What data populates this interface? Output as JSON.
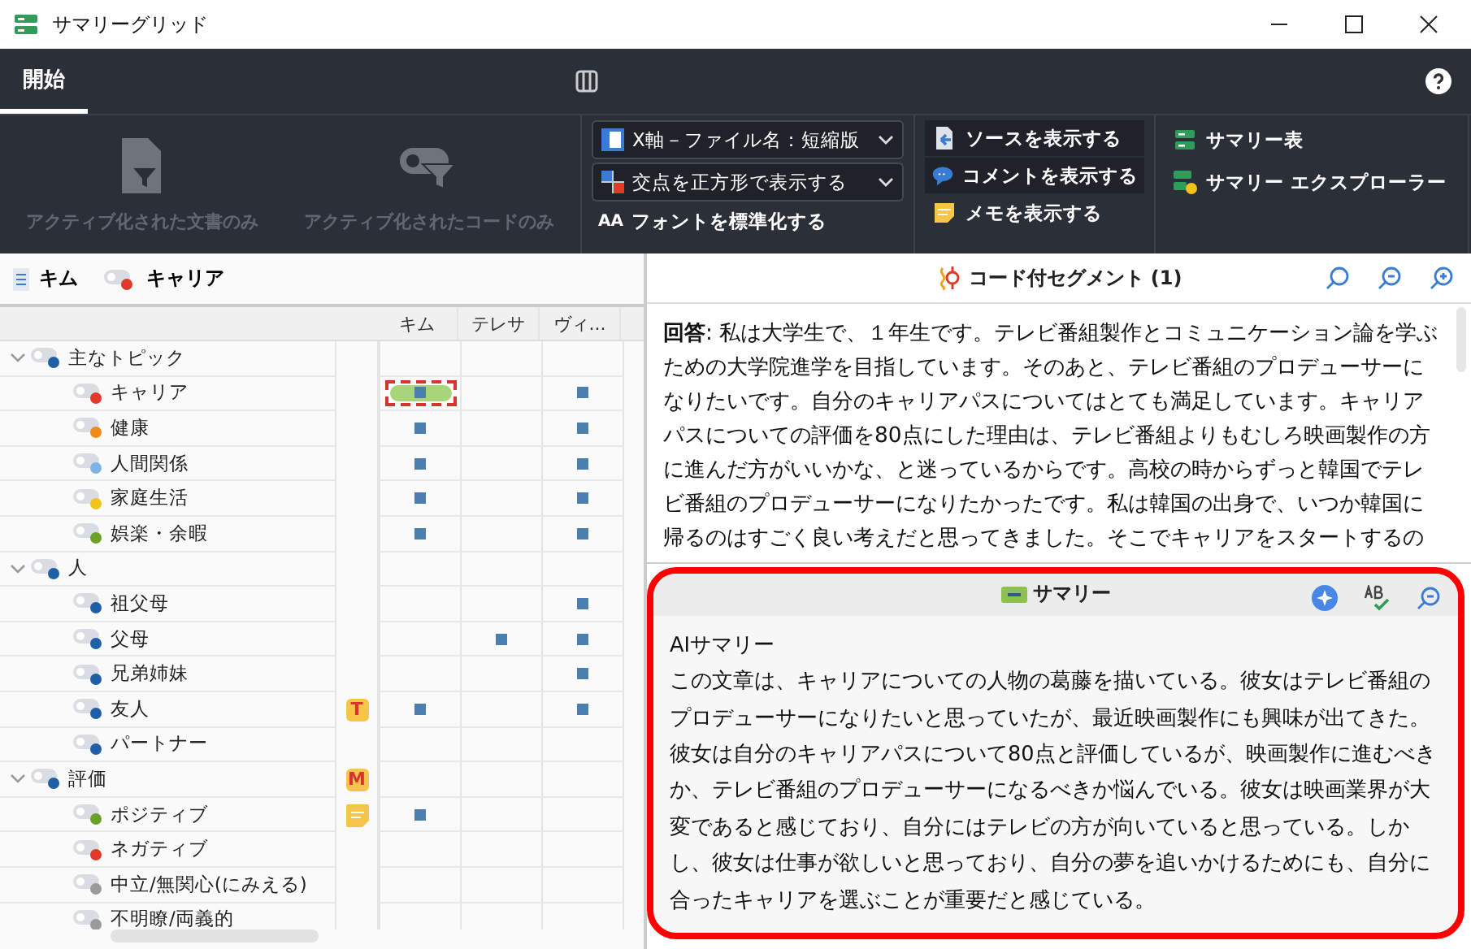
{
  "window": {
    "title": "サマリーグリッド"
  },
  "ribbon_tabs": [
    {
      "label": "開始",
      "selected": true
    }
  ],
  "ribbon": {
    "big_buttons": [
      {
        "label": "アクティブ化された文書のみ",
        "disabled": true,
        "kind": "document"
      },
      {
        "label": "アクティブ化されたコードのみ",
        "disabled": true,
        "kind": "code"
      }
    ],
    "dropdowns": [
      {
        "label": "X軸－ファイル名：短縮版",
        "kind": "axis"
      },
      {
        "label": "交点を正方形で表示する",
        "kind": "squares"
      }
    ],
    "normalize": {
      "icon_text": "AA",
      "label": "フォントを標準化する"
    },
    "toggles": [
      {
        "label": "ソースを表示する",
        "selected": true,
        "kind": "source"
      },
      {
        "label": "コメントを表示する",
        "selected": true,
        "kind": "comment"
      },
      {
        "label": "メモを表示する",
        "selected": false,
        "kind": "memo"
      }
    ],
    "summary_buttons": [
      {
        "label": "サマリー表",
        "kind": "table"
      },
      {
        "label": "サマリー エクスプローラー",
        "kind": "explorer"
      }
    ]
  },
  "selection": [
    {
      "kind": "document",
      "label": "キム"
    },
    {
      "kind": "code",
      "label": "キャリア",
      "color": "#e03a2a"
    }
  ],
  "matrix": {
    "columns": [
      "キム",
      "テレサ",
      "ヴィ..."
    ],
    "tree": [
      {
        "label": "主なトピック",
        "color": "#1f5fa8",
        "expanded": true,
        "children": [
          {
            "label": "キャリア",
            "color": "#e03a2a",
            "cells": [
              {
                "hit": true,
                "selected": true
              },
              {
                "hit": false,
                "selected": false
              },
              {
                "hit": true,
                "selected": false
              }
            ]
          },
          {
            "label": "健康",
            "color": "#f08a1c",
            "cells": [
              {
                "hit": true,
                "selected": false
              },
              {
                "hit": false,
                "selected": false
              },
              {
                "hit": true,
                "selected": false
              }
            ]
          },
          {
            "label": "人間関係",
            "color": "#7fb2e5",
            "cells": [
              {
                "hit": true,
                "selected": false
              },
              {
                "hit": false,
                "selected": false
              },
              {
                "hit": true,
                "selected": false
              }
            ]
          },
          {
            "label": "家庭生活",
            "color": "#f2c418",
            "cells": [
              {
                "hit": true,
                "selected": false
              },
              {
                "hit": false,
                "selected": false
              },
              {
                "hit": true,
                "selected": false
              }
            ]
          },
          {
            "label": "娯楽・余暇",
            "color": "#6aa126",
            "cells": [
              {
                "hit": true,
                "selected": false
              },
              {
                "hit": false,
                "selected": false
              },
              {
                "hit": true,
                "selected": false
              }
            ]
          }
        ]
      },
      {
        "label": "人",
        "color": "#1f5fa8",
        "expanded": true,
        "children": [
          {
            "label": "祖父母",
            "color": "#1f5fa8",
            "cells": [
              {
                "hit": false,
                "selected": false
              },
              {
                "hit": false,
                "selected": false
              },
              {
                "hit": true,
                "selected": false
              }
            ]
          },
          {
            "label": "父母",
            "color": "#1f5fa8",
            "cells": [
              {
                "hit": false,
                "selected": false
              },
              {
                "hit": true,
                "selected": false
              },
              {
                "hit": true,
                "selected": false
              }
            ]
          },
          {
            "label": "兄弟姉妹",
            "color": "#1f5fa8",
            "cells": [
              {
                "hit": false,
                "selected": false
              },
              {
                "hit": false,
                "selected": false
              },
              {
                "hit": true,
                "selected": false
              }
            ]
          },
          {
            "label": "友人",
            "color": "#1f5fa8",
            "memo": {
              "kind": "letter",
              "text": "T"
            },
            "cells": [
              {
                "hit": true,
                "selected": false
              },
              {
                "hit": false,
                "selected": false
              },
              {
                "hit": true,
                "selected": false
              }
            ]
          },
          {
            "label": "パートナー",
            "color": "#1f5fa8",
            "cells": [
              {
                "hit": false,
                "selected": false
              },
              {
                "hit": false,
                "selected": false
              },
              {
                "hit": false,
                "selected": false
              }
            ]
          }
        ]
      },
      {
        "label": "評価",
        "color": "#1f5fa8",
        "expanded": true,
        "memo": {
          "kind": "letter",
          "text": "M"
        },
        "children": [
          {
            "label": "ポジティブ",
            "color": "#6aa126",
            "memo": {
              "kind": "note"
            },
            "cells": [
              {
                "hit": true,
                "selected": false
              },
              {
                "hit": false,
                "selected": false
              },
              {
                "hit": false,
                "selected": false
              }
            ]
          },
          {
            "label": "ネガティブ",
            "color": "#e03a2a",
            "cells": [
              {
                "hit": false,
                "selected": false
              },
              {
                "hit": false,
                "selected": false
              },
              {
                "hit": false,
                "selected": false
              }
            ]
          },
          {
            "label": "中立/無関心(にみえる)",
            "color": "#9a9a9a",
            "cells": [
              {
                "hit": false,
                "selected": false
              },
              {
                "hit": false,
                "selected": false
              },
              {
                "hit": false,
                "selected": false
              }
            ]
          },
          {
            "label": "不明瞭/両義的",
            "color": "#9a9a9a",
            "cells": [
              {
                "hit": false,
                "selected": false
              },
              {
                "hit": false,
                "selected": false
              },
              {
                "hit": false,
                "selected": false
              }
            ]
          }
        ]
      }
    ]
  },
  "segments": {
    "title": "コード付セグメント (1)",
    "text": "**回答**: 私は大学生で、１年生です。テレビ番組製作とコミュニケーション論を学ぶための大学院進学を目指しています。そのあと、テレビ番組のプロデューサーになりたいです。自分のキャリアパスについてはとても満足しています。キャリアパスについての評価を80点にした理由は、テレビ番組よりもむしろ映画製作の方に進んだ方がいいかな、と迷っているからです。高校の時からずっと韓国でテレビ番組のプロデューサーになりたかったです。私は韓国の出身で、いつか韓国に帰るのはすごく良い考えだと思ってきました。そこでキャリアをスタートするの"
  },
  "summary": {
    "title": "サマリー",
    "heading": "AIサマリー",
    "text": "この文章は、キャリアについての人物の葛藤を描いている。彼女はテレビ番組のプロデューサーになりたいと思っていたが、最近映画製作にも興味が出てきた。彼女は自分のキャリアパスについて80点と評価しているが、映画製作に進むべきか、テレビ番組のプロデューサーになるべきか悩んでいる。彼女は映画業界が大変であると感じており、自分にはテレビの方が向いていると思っている。しかし、彼女は仕事が欲しいと思っており、自分の夢を追いかけるためにも、自分に合ったキャリアを選ぶことが重要だと感じている。",
    "highlighted": true
  }
}
